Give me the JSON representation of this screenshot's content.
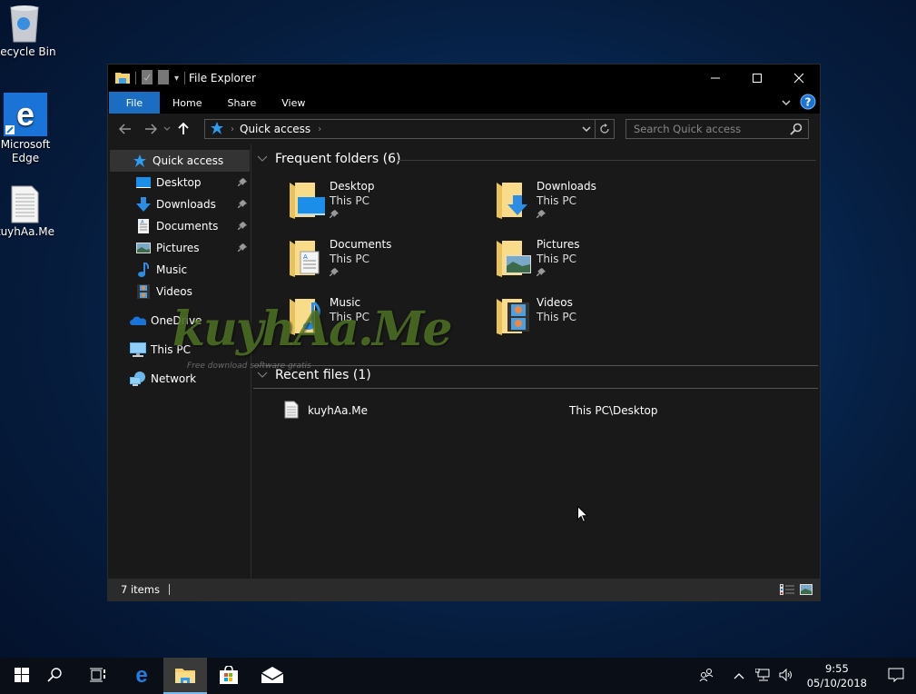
{
  "desktop": {
    "icons": [
      {
        "label": "Recycle Bin",
        "icon": "recycle-bin-icon"
      },
      {
        "label": "Microsoft Edge",
        "icon": "edge-icon"
      },
      {
        "label": "kuyhAa.Me",
        "icon": "text-file-icon"
      }
    ]
  },
  "window": {
    "title": "File Explorer",
    "controls": {
      "minimize": "minimize",
      "maximize": "maximize",
      "close": "close"
    },
    "ribbon_tabs": [
      {
        "label": "File",
        "active": true
      },
      {
        "label": "Home"
      },
      {
        "label": "Share"
      },
      {
        "label": "View"
      }
    ],
    "address": {
      "crumbs": [
        "Quick access"
      ]
    },
    "search": {
      "placeholder": "Search Quick access"
    },
    "sidebar": {
      "items": [
        {
          "label": "Quick access",
          "icon": "star-icon",
          "selected": true
        },
        {
          "label": "Desktop",
          "icon": "desktop-icon",
          "pinned": true
        },
        {
          "label": "Downloads",
          "icon": "downloads-icon",
          "pinned": true
        },
        {
          "label": "Documents",
          "icon": "documents-icon",
          "pinned": true
        },
        {
          "label": "Pictures",
          "icon": "pictures-icon",
          "pinned": true
        },
        {
          "label": "Music",
          "icon": "music-icon"
        },
        {
          "label": "Videos",
          "icon": "videos-icon"
        },
        {
          "label": "OneDrive",
          "icon": "onedrive-icon"
        },
        {
          "label": "This PC",
          "icon": "this-pc-icon"
        },
        {
          "label": "Network",
          "icon": "network-icon"
        }
      ]
    },
    "frequent": {
      "header": "Frequent folders (6)",
      "folders": [
        {
          "name": "Desktop",
          "location": "This PC",
          "pinned": true
        },
        {
          "name": "Downloads",
          "location": "This PC",
          "pinned": true
        },
        {
          "name": "Documents",
          "location": "This PC",
          "pinned": true
        },
        {
          "name": "Pictures",
          "location": "This PC",
          "pinned": true
        },
        {
          "name": "Music",
          "location": "This PC",
          "pinned": false
        },
        {
          "name": "Videos",
          "location": "This PC",
          "pinned": false
        }
      ]
    },
    "recent": {
      "header": "Recent files (1)",
      "files": [
        {
          "name": "kuyhAa.Me",
          "location": "This PC\\Desktop"
        }
      ]
    },
    "status": {
      "items": "7 items"
    },
    "watermark": {
      "text": "kuyhAa.Me",
      "sub": "Free download software gratis"
    }
  },
  "taskbar": {
    "buttons": [
      "start",
      "search",
      "task-view",
      "edge",
      "file-explorer",
      "store",
      "mail"
    ],
    "active": "file-explorer",
    "clock": {
      "time": "9:55",
      "date": "05/10/2018"
    }
  }
}
